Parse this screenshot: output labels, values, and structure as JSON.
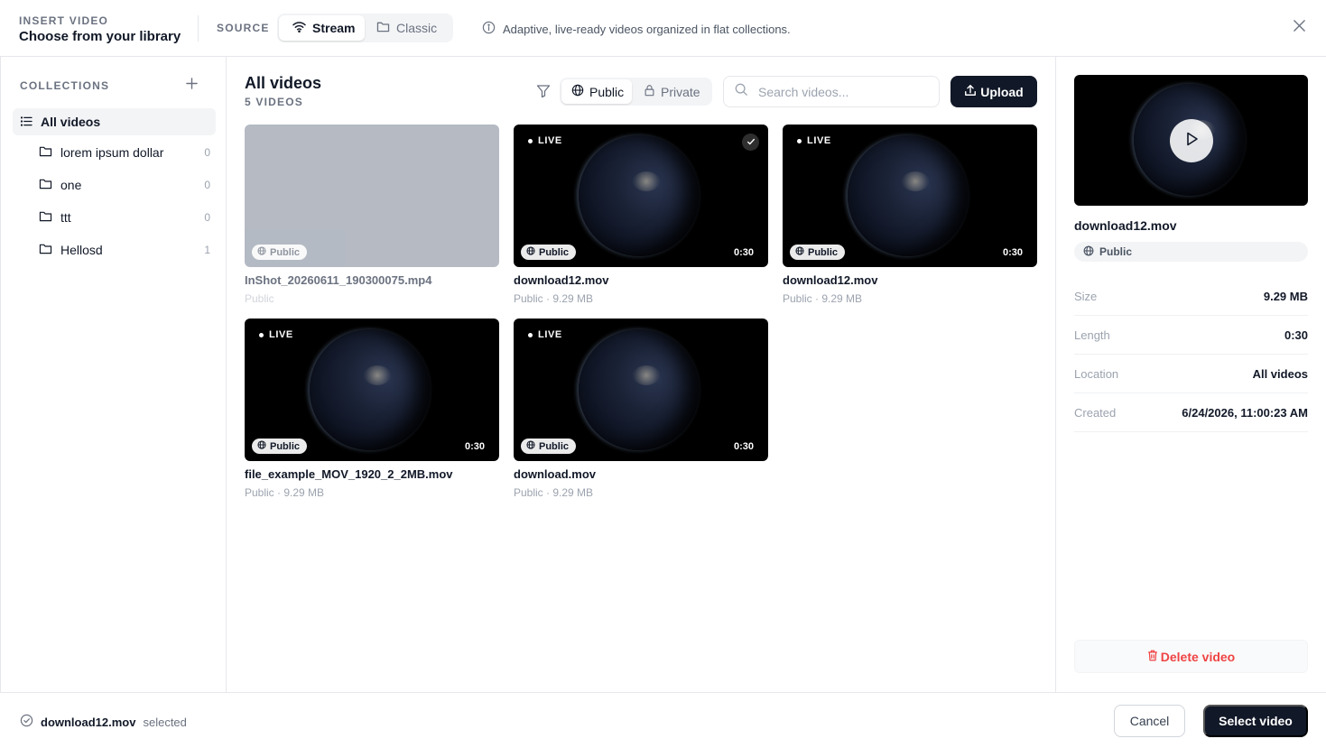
{
  "header": {
    "eyebrow": "INSERT VIDEO",
    "title": "Choose from your library",
    "source_label": "SOURCE",
    "source_tabs": [
      {
        "label": "Stream",
        "icon": "wifi-icon",
        "active": true
      },
      {
        "label": "Classic",
        "icon": "folder-icon",
        "active": false
      }
    ],
    "info_text": "Adaptive, live-ready videos organized in flat collections."
  },
  "sidebar": {
    "label": "COLLECTIONS",
    "all_label": "All videos",
    "folders": [
      {
        "name": "lorem ipsum dollar",
        "count": "0"
      },
      {
        "name": "one",
        "count": "0"
      },
      {
        "name": "ttt",
        "count": "0"
      },
      {
        "name": "Hellosd",
        "count": "1"
      }
    ]
  },
  "main": {
    "title": "All videos",
    "count_label": "5 VIDEOS",
    "visibility": [
      {
        "label": "Public",
        "icon": "globe-icon",
        "active": true
      },
      {
        "label": "Private",
        "icon": "lock-icon",
        "active": false
      }
    ],
    "search_placeholder": "Search videos...",
    "upload_label": "Upload",
    "cards": [
      {
        "name": "InShot_20260611_190300075.mp4",
        "meta": "Public",
        "badge": "Public",
        "live": "",
        "duration": "",
        "selected": false,
        "placeholder": true
      },
      {
        "name": "download12.mov",
        "meta": "Public · 9.29 MB",
        "badge": "Public",
        "live": "LIVE",
        "duration": "0:30",
        "selected": true,
        "placeholder": false
      },
      {
        "name": "download12.mov",
        "meta": "Public · 9.29 MB",
        "badge": "Public",
        "live": "LIVE",
        "duration": "0:30",
        "selected": false,
        "placeholder": false
      },
      {
        "name": "file_example_MOV_1920_2_2MB.mov",
        "meta": "Public · 9.29 MB",
        "badge": "Public",
        "live": "LIVE",
        "duration": "0:30",
        "selected": false,
        "placeholder": false
      },
      {
        "name": "download.mov",
        "meta": "Public · 9.29 MB",
        "badge": "Public",
        "live": "LIVE",
        "duration": "0:30",
        "selected": false,
        "placeholder": false
      }
    ]
  },
  "details": {
    "name": "download12.mov",
    "badge": "Public",
    "rows": [
      {
        "key": "Size",
        "value": "9.29 MB"
      },
      {
        "key": "Length",
        "value": "0:30"
      },
      {
        "key": "Location",
        "value": "All videos"
      },
      {
        "key": "Created",
        "value": "6/24/2026, 11:00:23 AM"
      }
    ],
    "delete_label": "Delete video"
  },
  "footer": {
    "selected_name": "download12.mov",
    "selected_suffix": "selected",
    "cancel_label": "Cancel",
    "select_label": "Select video"
  },
  "colors": {
    "primary": "#111827",
    "danger": "#ef4444",
    "muted": "#6b7280",
    "border": "#e5e7eb"
  }
}
